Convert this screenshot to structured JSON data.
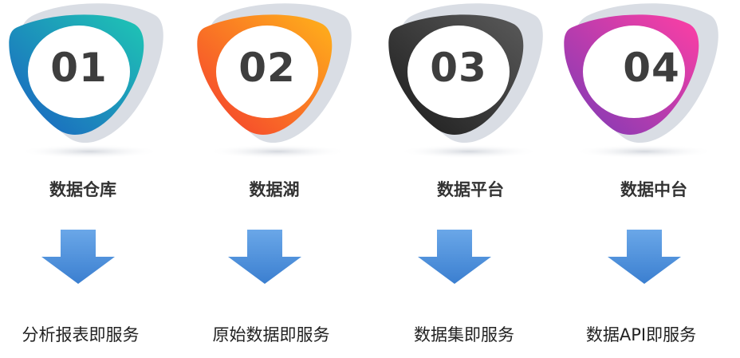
{
  "steps": [
    {
      "number": "01",
      "title": "数据仓库",
      "service": "分析报表即服务",
      "gradient": [
        "#1fc7b4",
        "#1a5fc2"
      ]
    },
    {
      "number": "02",
      "title": "数据湖",
      "service": "原始数据即服务",
      "gradient": [
        "#ffb31a",
        "#f43a2f"
      ]
    },
    {
      "number": "03",
      "title": "数据平台",
      "service": "数据集即服务",
      "gradient": [
        "#5a5a5a",
        "#1b1b1b"
      ]
    },
    {
      "number": "04",
      "title": "数据中台",
      "service": "数据API即服务",
      "gradient": [
        "#ff3fa4",
        "#7a3ab6"
      ]
    }
  ],
  "arrow_color": "#4a8fd8"
}
